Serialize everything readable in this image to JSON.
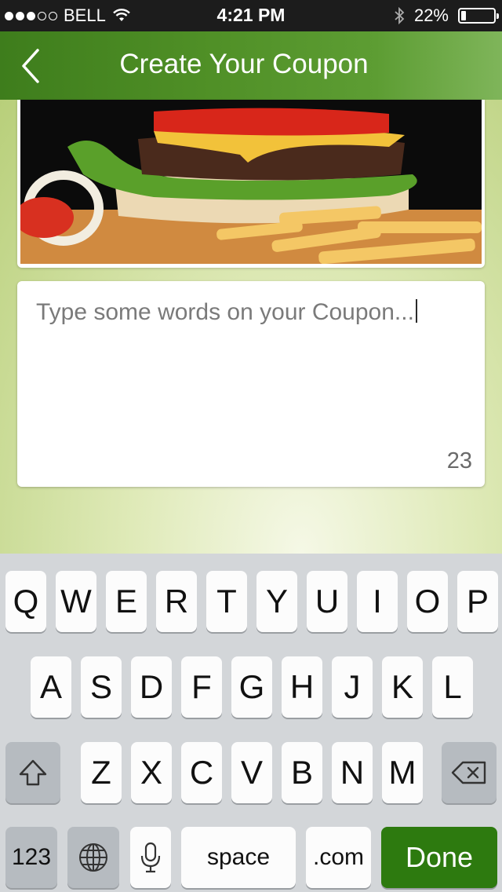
{
  "status": {
    "carrier": "BELL",
    "time": "4:21 PM",
    "battery": "22%",
    "battery_level": 0.22,
    "signal_bars_filled": 3,
    "signal_bars_total": 5
  },
  "nav": {
    "title": "Create Your Coupon",
    "back_icon": "chevron-left-icon"
  },
  "coupon": {
    "image_alt": "hamburger-with-fries-photo",
    "placeholder": "Type some words on your Coupon...",
    "char_count": "23"
  },
  "keyboard": {
    "row1": [
      "Q",
      "W",
      "E",
      "R",
      "T",
      "Y",
      "U",
      "I",
      "O",
      "P"
    ],
    "row2": [
      "A",
      "S",
      "D",
      "F",
      "G",
      "H",
      "J",
      "K",
      "L"
    ],
    "row3": [
      "Z",
      "X",
      "C",
      "V",
      "B",
      "N",
      "M"
    ],
    "numbers_key": "123",
    "space_key": "space",
    "dotcom_key": ".com",
    "done_key": "Done",
    "colors": {
      "done": "#2d7a0f",
      "navbar": "#4f8f26"
    }
  }
}
